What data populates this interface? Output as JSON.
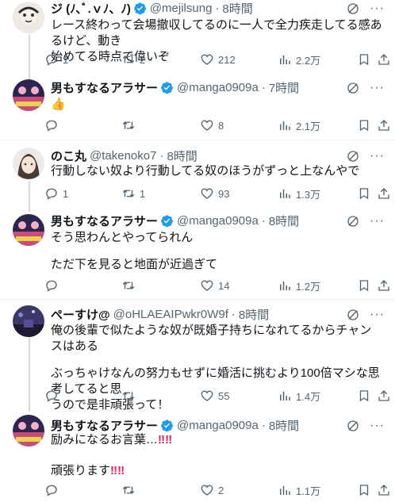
{
  "tweets": [
    {
      "name": "ジ (ﾉ､ﾞ.ｖﾉ、ﾉ) ",
      "handle": "@mejilsung",
      "time": "8時間",
      "verified": true,
      "lines": [
        "レース終わって会場撤収してるのに一人で全力疾走してる感あるけど、動き",
        "始めてる時点で偉いぞ"
      ],
      "reply_count": "1",
      "repost_count": "2",
      "like_count": "212",
      "view_count": "2.2万"
    },
    {
      "name": "男もすなるアラサー",
      "handle": "@manga0909a",
      "time": "7時間",
      "verified": true,
      "lines": [
        "👍"
      ],
      "reply_count": "",
      "repost_count": "",
      "like_count": "8",
      "view_count": "2.1万"
    },
    {
      "name": "のこ丸",
      "handle": "@takenoko7",
      "time": "8時間",
      "verified": false,
      "lines": [
        "行動しない奴より行動してる奴のほうがずっと上なんやで"
      ],
      "reply_count": "1",
      "repost_count": "1",
      "like_count": "93",
      "view_count": "1.3万"
    },
    {
      "name": "男もすなるアラサー",
      "handle": "@manga0909a",
      "time": "8時間",
      "verified": true,
      "lines": [
        "そう思わんとやってられん",
        "",
        "ただ下を見ると地面が近過ぎて"
      ],
      "reply_count": "",
      "repost_count": "",
      "like_count": "14",
      "view_count": "1.2万"
    },
    {
      "name": "ぺーすけ@",
      "handle": "@oHLAEAIPwkr0W9f",
      "time": "8時間",
      "verified": false,
      "lines": [
        "俺の後輩で似たような奴が既婚子持ちになれてるからチャンスはある",
        "",
        "ぶっちゃけなんの努力もせずに婚活に挑むより100倍マシな思考してると思",
        "うので是非頑張って！"
      ],
      "reply_count": "",
      "repost_count": "",
      "like_count": "55",
      "view_count": "1.4万"
    },
    {
      "name": "男もすなるアラサー",
      "handle": "@manga0909a",
      "time": "8時間",
      "verified": true,
      "lines": [
        "励みになるお言葉…",
        "",
        "",
        "頑張ります"
      ],
      "exclaim": "‼‼",
      "reply_count": "",
      "repost_count": "",
      "like_count": "2",
      "view_count": "1.1万"
    }
  ],
  "icons": {
    "reply": "reply-icon",
    "repost": "repost-icon",
    "like": "like-icon",
    "views": "views-icon",
    "bookmark": "bookmark-icon",
    "share": "share-icon",
    "grok": "grok-icon",
    "more": "more-icon",
    "verified": "verified-badge-icon"
  },
  "colors": {
    "text": "#0f1419",
    "secondary": "#536471",
    "verified": "#1d9bf0",
    "separator": "#eff3f4",
    "thread_line": "#cfd9de",
    "emoji_red": "#e0245e"
  }
}
